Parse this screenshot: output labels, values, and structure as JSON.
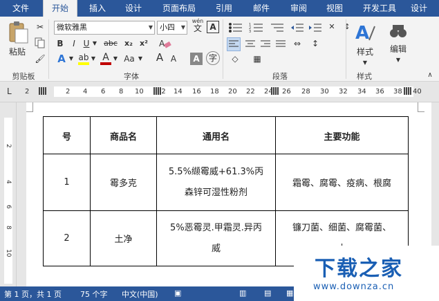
{
  "tabs": [
    {
      "label": "文件"
    },
    {
      "label": "开始"
    },
    {
      "label": "插入"
    },
    {
      "label": "设计"
    },
    {
      "label": "页面布局"
    },
    {
      "label": "引用"
    },
    {
      "label": "邮件"
    },
    {
      "label": "审阅"
    },
    {
      "label": "视图"
    },
    {
      "label": "开发工具"
    },
    {
      "label": "设计"
    }
  ],
  "ribbon": {
    "clipboard": {
      "paste_label": "粘贴",
      "group_label": "剪贴板"
    },
    "font": {
      "font_name": "微软雅黑",
      "font_size": "小四",
      "wen_label": "wén",
      "wen_char": "文",
      "bold": "B",
      "italic": "I",
      "underline": "U",
      "strike": "abc",
      "subscript": "x₂",
      "superscript": "x²",
      "grow": "A",
      "shrink": "A",
      "aa": "Aa",
      "group_label": "字体"
    },
    "paragraph": {
      "group_label": "段落"
    },
    "styles": {
      "label": "样式",
      "group_label": "样式"
    },
    "editing": {
      "label": "编辑"
    }
  },
  "ruler_h": [
    "2",
    "2",
    "4",
    "6",
    "8",
    "10",
    "12",
    "14",
    "16",
    "18",
    "20",
    "22",
    "24",
    "26",
    "28",
    "30",
    "32",
    "34",
    "36",
    "38",
    "40"
  ],
  "ruler_v": [
    "2",
    "4",
    "6",
    "8",
    "10"
  ],
  "table": {
    "headers": [
      "号",
      "商品名",
      "通用名",
      "主要功能"
    ],
    "rows": [
      {
        "no": "1",
        "name": "霉多克",
        "generic": [
          "5.5%缬霉威+61.3%丙",
          "森锌可湿性粉剂"
        ],
        "function": "霜霉、腐霉、疫病、根腐"
      },
      {
        "no": "2",
        "name": "土净",
        "generic": [
          "5%恶霉灵.甲霜灵.异丙",
          "威"
        ],
        "function": [
          "镰刀菌、细菌、腐霉菌、",
          "小"
        ]
      }
    ]
  },
  "status": {
    "page": "第 1 页，共 1 页",
    "words": "75 个字",
    "language": "中文(中国)"
  },
  "watermark": {
    "title": "下载之家",
    "url": "www.downza.cn"
  },
  "colors": {
    "ribbon_blue": "#2b579a",
    "accent": "#1a5fb4",
    "font_color_red": "#c00000",
    "highlight_yellow": "#ffff00"
  }
}
